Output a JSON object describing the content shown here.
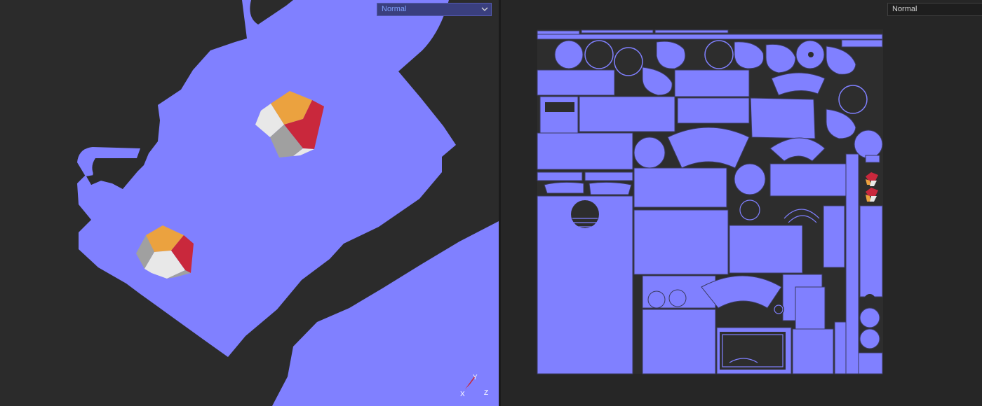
{
  "viewport3d": {
    "mode_select": {
      "value": "Normal"
    },
    "axes": {
      "x": "X",
      "y": "Y",
      "z": "Z"
    }
  },
  "uv_editor": {
    "mode_select": {
      "value": "Normal"
    }
  },
  "colors": {
    "normal_blue": "#8080ff",
    "background": "#2b2b2b",
    "cube_orange": "#eba23f",
    "cube_red": "#c9283c",
    "cube_gray": "#a0a0a0",
    "cube_white": "#e8e8e8"
  },
  "icons": {
    "dropdown": "chevron-down-icon",
    "gizmo": "axis-gizmo-icon"
  }
}
